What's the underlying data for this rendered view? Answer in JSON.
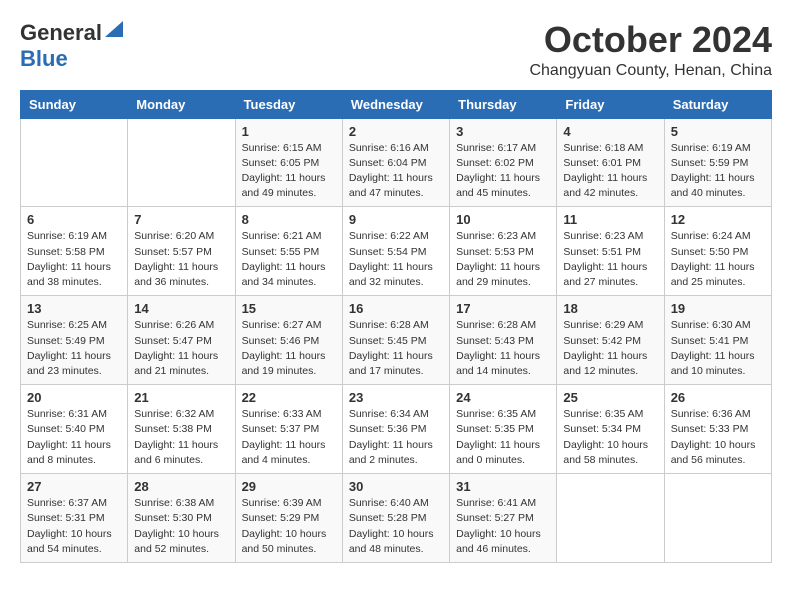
{
  "header": {
    "logo_general": "General",
    "logo_blue": "Blue",
    "month": "October 2024",
    "location": "Changyuan County, Henan, China"
  },
  "weekdays": [
    "Sunday",
    "Monday",
    "Tuesday",
    "Wednesday",
    "Thursday",
    "Friday",
    "Saturday"
  ],
  "weeks": [
    [
      {
        "day": "",
        "info": ""
      },
      {
        "day": "",
        "info": ""
      },
      {
        "day": "1",
        "info": "Sunrise: 6:15 AM\nSunset: 6:05 PM\nDaylight: 11 hours and 49 minutes."
      },
      {
        "day": "2",
        "info": "Sunrise: 6:16 AM\nSunset: 6:04 PM\nDaylight: 11 hours and 47 minutes."
      },
      {
        "day": "3",
        "info": "Sunrise: 6:17 AM\nSunset: 6:02 PM\nDaylight: 11 hours and 45 minutes."
      },
      {
        "day": "4",
        "info": "Sunrise: 6:18 AM\nSunset: 6:01 PM\nDaylight: 11 hours and 42 minutes."
      },
      {
        "day": "5",
        "info": "Sunrise: 6:19 AM\nSunset: 5:59 PM\nDaylight: 11 hours and 40 minutes."
      }
    ],
    [
      {
        "day": "6",
        "info": "Sunrise: 6:19 AM\nSunset: 5:58 PM\nDaylight: 11 hours and 38 minutes."
      },
      {
        "day": "7",
        "info": "Sunrise: 6:20 AM\nSunset: 5:57 PM\nDaylight: 11 hours and 36 minutes."
      },
      {
        "day": "8",
        "info": "Sunrise: 6:21 AM\nSunset: 5:55 PM\nDaylight: 11 hours and 34 minutes."
      },
      {
        "day": "9",
        "info": "Sunrise: 6:22 AM\nSunset: 5:54 PM\nDaylight: 11 hours and 32 minutes."
      },
      {
        "day": "10",
        "info": "Sunrise: 6:23 AM\nSunset: 5:53 PM\nDaylight: 11 hours and 29 minutes."
      },
      {
        "day": "11",
        "info": "Sunrise: 6:23 AM\nSunset: 5:51 PM\nDaylight: 11 hours and 27 minutes."
      },
      {
        "day": "12",
        "info": "Sunrise: 6:24 AM\nSunset: 5:50 PM\nDaylight: 11 hours and 25 minutes."
      }
    ],
    [
      {
        "day": "13",
        "info": "Sunrise: 6:25 AM\nSunset: 5:49 PM\nDaylight: 11 hours and 23 minutes."
      },
      {
        "day": "14",
        "info": "Sunrise: 6:26 AM\nSunset: 5:47 PM\nDaylight: 11 hours and 21 minutes."
      },
      {
        "day": "15",
        "info": "Sunrise: 6:27 AM\nSunset: 5:46 PM\nDaylight: 11 hours and 19 minutes."
      },
      {
        "day": "16",
        "info": "Sunrise: 6:28 AM\nSunset: 5:45 PM\nDaylight: 11 hours and 17 minutes."
      },
      {
        "day": "17",
        "info": "Sunrise: 6:28 AM\nSunset: 5:43 PM\nDaylight: 11 hours and 14 minutes."
      },
      {
        "day": "18",
        "info": "Sunrise: 6:29 AM\nSunset: 5:42 PM\nDaylight: 11 hours and 12 minutes."
      },
      {
        "day": "19",
        "info": "Sunrise: 6:30 AM\nSunset: 5:41 PM\nDaylight: 11 hours and 10 minutes."
      }
    ],
    [
      {
        "day": "20",
        "info": "Sunrise: 6:31 AM\nSunset: 5:40 PM\nDaylight: 11 hours and 8 minutes."
      },
      {
        "day": "21",
        "info": "Sunrise: 6:32 AM\nSunset: 5:38 PM\nDaylight: 11 hours and 6 minutes."
      },
      {
        "day": "22",
        "info": "Sunrise: 6:33 AM\nSunset: 5:37 PM\nDaylight: 11 hours and 4 minutes."
      },
      {
        "day": "23",
        "info": "Sunrise: 6:34 AM\nSunset: 5:36 PM\nDaylight: 11 hours and 2 minutes."
      },
      {
        "day": "24",
        "info": "Sunrise: 6:35 AM\nSunset: 5:35 PM\nDaylight: 11 hours and 0 minutes."
      },
      {
        "day": "25",
        "info": "Sunrise: 6:35 AM\nSunset: 5:34 PM\nDaylight: 10 hours and 58 minutes."
      },
      {
        "day": "26",
        "info": "Sunrise: 6:36 AM\nSunset: 5:33 PM\nDaylight: 10 hours and 56 minutes."
      }
    ],
    [
      {
        "day": "27",
        "info": "Sunrise: 6:37 AM\nSunset: 5:31 PM\nDaylight: 10 hours and 54 minutes."
      },
      {
        "day": "28",
        "info": "Sunrise: 6:38 AM\nSunset: 5:30 PM\nDaylight: 10 hours and 52 minutes."
      },
      {
        "day": "29",
        "info": "Sunrise: 6:39 AM\nSunset: 5:29 PM\nDaylight: 10 hours and 50 minutes."
      },
      {
        "day": "30",
        "info": "Sunrise: 6:40 AM\nSunset: 5:28 PM\nDaylight: 10 hours and 48 minutes."
      },
      {
        "day": "31",
        "info": "Sunrise: 6:41 AM\nSunset: 5:27 PM\nDaylight: 10 hours and 46 minutes."
      },
      {
        "day": "",
        "info": ""
      },
      {
        "day": "",
        "info": ""
      }
    ]
  ]
}
